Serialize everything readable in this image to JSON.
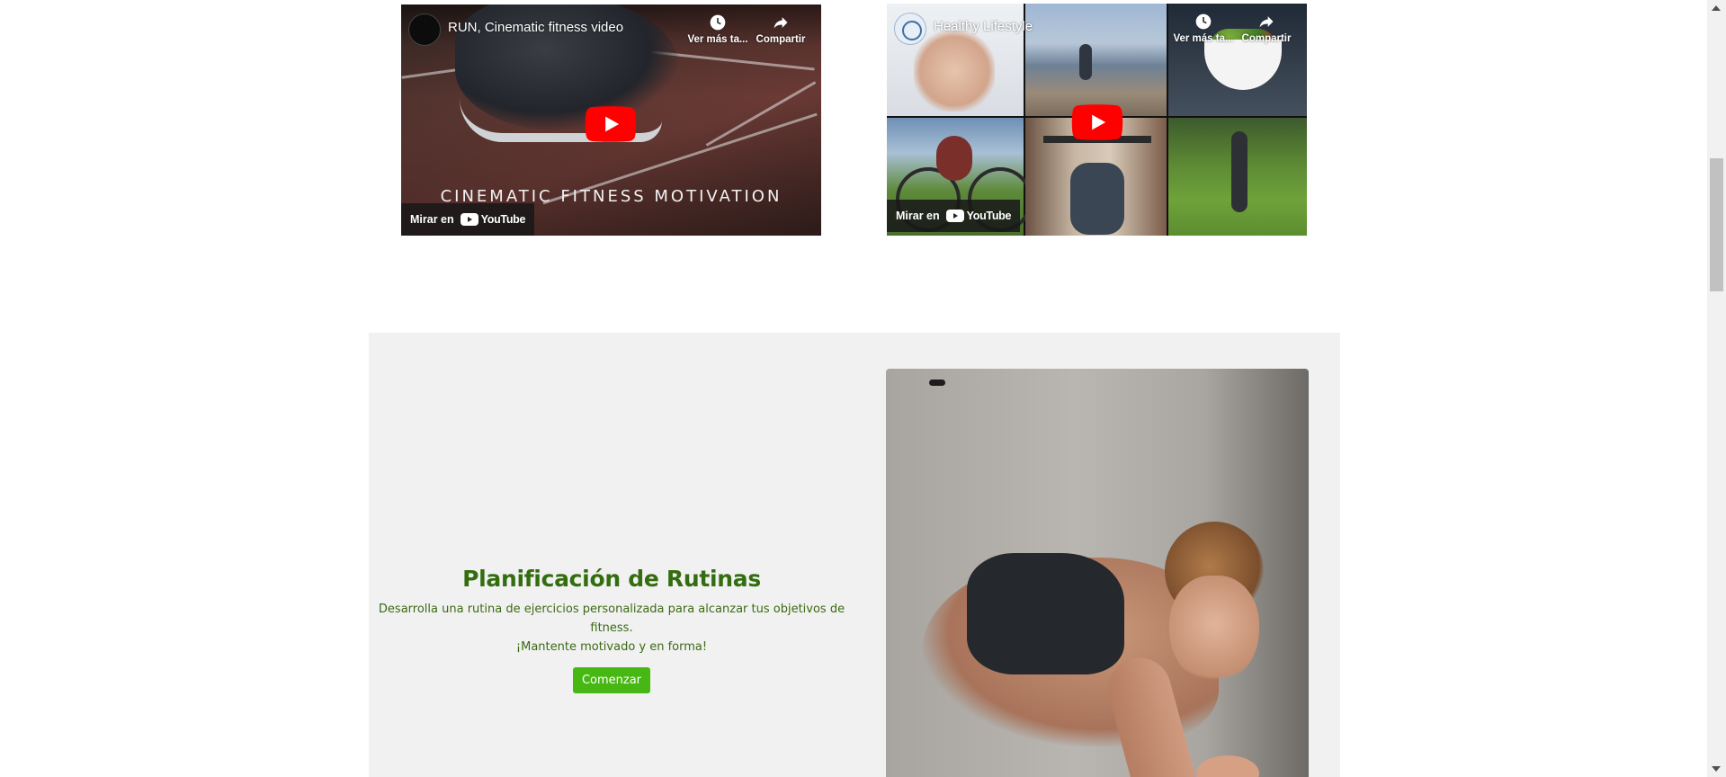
{
  "videos": [
    {
      "title": "RUN, Cinematic fitness video",
      "caption": "CINEMATIC FITNESS MOTIVATION",
      "watch_later_label": "Ver más ta...",
      "share_label": "Compartir",
      "watch_on_label": "Mirar en",
      "youtube_label": "YouTube"
    },
    {
      "title": "Healthy Lifestyle",
      "watch_later_label": "Ver más ta...",
      "share_label": "Compartir",
      "watch_on_label": "Mirar en",
      "youtube_label": "YouTube"
    }
  ],
  "feature": {
    "title": "Planificación de Rutinas",
    "description_line1": "Desarrolla una rutina de ejercicios personalizada para alcanzar tus objetivos de fitness.",
    "description_line2": "¡Mantente motivado y en forma!",
    "button_label": "Comenzar"
  },
  "colors": {
    "title_green": "#336d0f",
    "button_green": "#47b813",
    "section_bg": "#f1f1f1",
    "youtube_red": "#ff0000"
  },
  "icons": [
    "clock-icon",
    "share-arrow-icon",
    "play-icon",
    "youtube-logo-icon"
  ]
}
